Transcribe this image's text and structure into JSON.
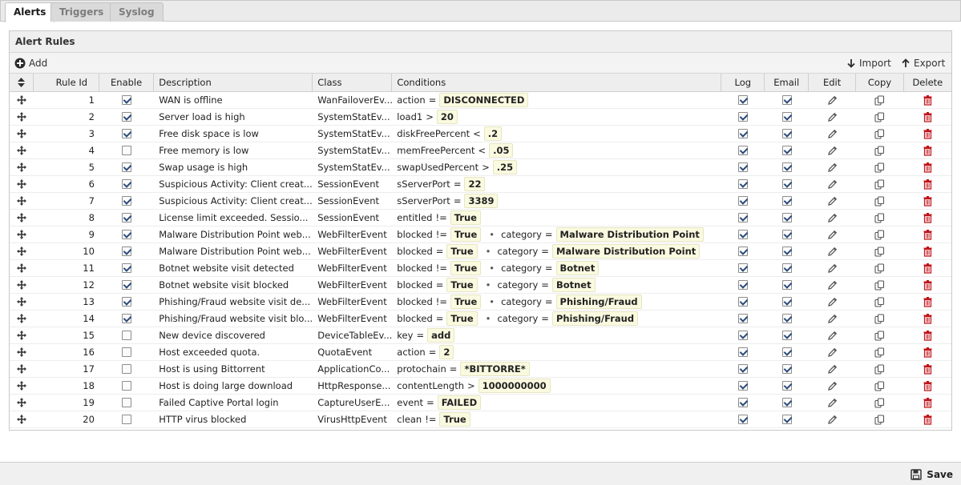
{
  "tabs": [
    {
      "label": "Alerts",
      "active": true
    },
    {
      "label": "Triggers",
      "active": false
    },
    {
      "label": "Syslog",
      "active": false
    }
  ],
  "panel_title": "Alert Rules",
  "toolbar": {
    "add_label": "Add",
    "import_label": "Import",
    "export_label": "Export"
  },
  "columns": [
    "Rule Id",
    "Enable",
    "Description",
    "Class",
    "Conditions",
    "Log",
    "Email",
    "Edit",
    "Copy",
    "Delete"
  ],
  "rows": [
    {
      "id": "1",
      "enable": true,
      "description": "WAN is offline",
      "class": "WanFailoverEv...",
      "conditions": [
        {
          "field": "action",
          "op": "=",
          "value": "DISCONNECTED"
        }
      ],
      "log": true,
      "email": true
    },
    {
      "id": "2",
      "enable": true,
      "description": "Server load is high",
      "class": "SystemStatEv...",
      "conditions": [
        {
          "field": "load1",
          "op": ">",
          "value": "20"
        }
      ],
      "log": true,
      "email": true
    },
    {
      "id": "3",
      "enable": true,
      "description": "Free disk space is low",
      "class": "SystemStatEv...",
      "conditions": [
        {
          "field": "diskFreePercent",
          "op": "<",
          "value": ".2"
        }
      ],
      "log": true,
      "email": true
    },
    {
      "id": "4",
      "enable": false,
      "description": "Free memory is low",
      "class": "SystemStatEv...",
      "conditions": [
        {
          "field": "memFreePercent",
          "op": "<",
          "value": ".05"
        }
      ],
      "log": true,
      "email": true
    },
    {
      "id": "5",
      "enable": true,
      "description": "Swap usage is high",
      "class": "SystemStatEv...",
      "conditions": [
        {
          "field": "swapUsedPercent",
          "op": ">",
          "value": ".25"
        }
      ],
      "log": true,
      "email": true
    },
    {
      "id": "6",
      "enable": true,
      "description": "Suspicious Activity: Client creat...",
      "class": "SessionEvent",
      "conditions": [
        {
          "field": "sServerPort",
          "op": "=",
          "value": "22"
        }
      ],
      "log": true,
      "email": true
    },
    {
      "id": "7",
      "enable": true,
      "description": "Suspicious Activity: Client creat...",
      "class": "SessionEvent",
      "conditions": [
        {
          "field": "sServerPort",
          "op": "=",
          "value": "3389"
        }
      ],
      "log": true,
      "email": true
    },
    {
      "id": "8",
      "enable": true,
      "description": "License limit exceeded. Sessio...",
      "class": "SessionEvent",
      "conditions": [
        {
          "field": "entitled",
          "op": "!=",
          "value": "True"
        }
      ],
      "log": true,
      "email": true
    },
    {
      "id": "9",
      "enable": true,
      "description": "Malware Distribution Point web...",
      "class": "WebFilterEvent",
      "conditions": [
        {
          "field": "blocked",
          "op": "!=",
          "value": "True"
        },
        {
          "field": "category",
          "op": "=",
          "value": "Malware Distribution Point"
        }
      ],
      "log": true,
      "email": true
    },
    {
      "id": "10",
      "enable": true,
      "description": "Malware Distribution Point web...",
      "class": "WebFilterEvent",
      "conditions": [
        {
          "field": "blocked",
          "op": "=",
          "value": "True"
        },
        {
          "field": "category",
          "op": "=",
          "value": "Malware Distribution Point"
        }
      ],
      "log": true,
      "email": true
    },
    {
      "id": "11",
      "enable": true,
      "description": "Botnet website visit detected",
      "class": "WebFilterEvent",
      "conditions": [
        {
          "field": "blocked",
          "op": "!=",
          "value": "True"
        },
        {
          "field": "category",
          "op": "=",
          "value": "Botnet"
        }
      ],
      "log": true,
      "email": true
    },
    {
      "id": "12",
      "enable": true,
      "description": "Botnet website visit blocked",
      "class": "WebFilterEvent",
      "conditions": [
        {
          "field": "blocked",
          "op": "=",
          "value": "True"
        },
        {
          "field": "category",
          "op": "=",
          "value": "Botnet"
        }
      ],
      "log": true,
      "email": true
    },
    {
      "id": "13",
      "enable": true,
      "description": "Phishing/Fraud website visit de...",
      "class": "WebFilterEvent",
      "conditions": [
        {
          "field": "blocked",
          "op": "!=",
          "value": "True"
        },
        {
          "field": "category",
          "op": "=",
          "value": "Phishing/Fraud"
        }
      ],
      "log": true,
      "email": true
    },
    {
      "id": "14",
      "enable": true,
      "description": "Phishing/Fraud website visit blo...",
      "class": "WebFilterEvent",
      "conditions": [
        {
          "field": "blocked",
          "op": "=",
          "value": "True"
        },
        {
          "field": "category",
          "op": "=",
          "value": "Phishing/Fraud"
        }
      ],
      "log": true,
      "email": true
    },
    {
      "id": "15",
      "enable": false,
      "description": "New device discovered",
      "class": "DeviceTableEv...",
      "conditions": [
        {
          "field": "key",
          "op": "=",
          "value": "add"
        }
      ],
      "log": true,
      "email": true
    },
    {
      "id": "16",
      "enable": false,
      "description": "Host exceeded quota.",
      "class": "QuotaEvent",
      "conditions": [
        {
          "field": "action",
          "op": "=",
          "value": "2"
        }
      ],
      "log": true,
      "email": true
    },
    {
      "id": "17",
      "enable": false,
      "description": "Host is using Bittorrent",
      "class": "ApplicationCo...",
      "conditions": [
        {
          "field": "protochain",
          "op": "=",
          "value": "*BITTORRE*"
        }
      ],
      "log": true,
      "email": true
    },
    {
      "id": "18",
      "enable": false,
      "description": "Host is doing large download",
      "class": "HttpResponse...",
      "conditions": [
        {
          "field": "contentLength",
          "op": ">",
          "value": "1000000000"
        }
      ],
      "log": true,
      "email": true
    },
    {
      "id": "19",
      "enable": false,
      "description": "Failed Captive Portal login",
      "class": "CaptureUserE...",
      "conditions": [
        {
          "field": "event",
          "op": "=",
          "value": "FAILED"
        }
      ],
      "log": true,
      "email": true
    },
    {
      "id": "20",
      "enable": false,
      "description": "HTTP virus blocked",
      "class": "VirusHttpEvent",
      "conditions": [
        {
          "field": "clean",
          "op": "!=",
          "value": "True"
        }
      ],
      "log": true,
      "email": true
    }
  ],
  "save_label": "Save",
  "colors": {
    "delete_icon": "#c0141a",
    "value_bg": "#fafae0"
  }
}
